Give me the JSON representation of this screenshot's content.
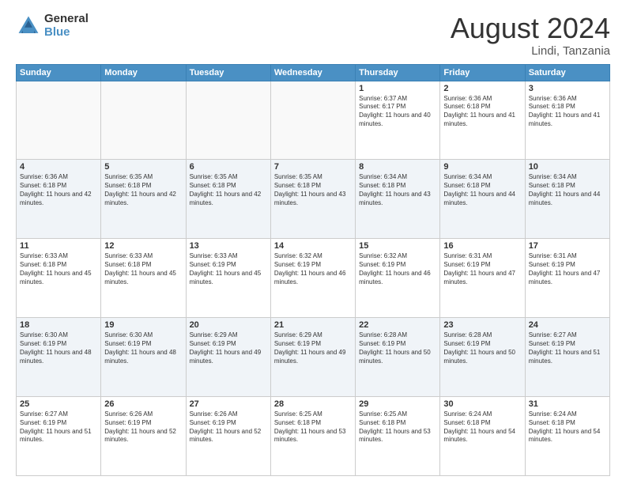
{
  "logo": {
    "general": "General",
    "blue": "Blue"
  },
  "header": {
    "month": "August 2024",
    "location": "Lindi, Tanzania"
  },
  "weekdays": [
    "Sunday",
    "Monday",
    "Tuesday",
    "Wednesday",
    "Thursday",
    "Friday",
    "Saturday"
  ],
  "weeks": [
    [
      {
        "day": "",
        "sunrise": "",
        "sunset": "",
        "daylight": ""
      },
      {
        "day": "",
        "sunrise": "",
        "sunset": "",
        "daylight": ""
      },
      {
        "day": "",
        "sunrise": "",
        "sunset": "",
        "daylight": ""
      },
      {
        "day": "",
        "sunrise": "",
        "sunset": "",
        "daylight": ""
      },
      {
        "day": "1",
        "sunrise": "Sunrise: 6:37 AM",
        "sunset": "Sunset: 6:17 PM",
        "daylight": "Daylight: 11 hours and 40 minutes."
      },
      {
        "day": "2",
        "sunrise": "Sunrise: 6:36 AM",
        "sunset": "Sunset: 6:18 PM",
        "daylight": "Daylight: 11 hours and 41 minutes."
      },
      {
        "day": "3",
        "sunrise": "Sunrise: 6:36 AM",
        "sunset": "Sunset: 6:18 PM",
        "daylight": "Daylight: 11 hours and 41 minutes."
      }
    ],
    [
      {
        "day": "4",
        "sunrise": "Sunrise: 6:36 AM",
        "sunset": "Sunset: 6:18 PM",
        "daylight": "Daylight: 11 hours and 42 minutes."
      },
      {
        "day": "5",
        "sunrise": "Sunrise: 6:35 AM",
        "sunset": "Sunset: 6:18 PM",
        "daylight": "Daylight: 11 hours and 42 minutes."
      },
      {
        "day": "6",
        "sunrise": "Sunrise: 6:35 AM",
        "sunset": "Sunset: 6:18 PM",
        "daylight": "Daylight: 11 hours and 42 minutes."
      },
      {
        "day": "7",
        "sunrise": "Sunrise: 6:35 AM",
        "sunset": "Sunset: 6:18 PM",
        "daylight": "Daylight: 11 hours and 43 minutes."
      },
      {
        "day": "8",
        "sunrise": "Sunrise: 6:34 AM",
        "sunset": "Sunset: 6:18 PM",
        "daylight": "Daylight: 11 hours and 43 minutes."
      },
      {
        "day": "9",
        "sunrise": "Sunrise: 6:34 AM",
        "sunset": "Sunset: 6:18 PM",
        "daylight": "Daylight: 11 hours and 44 minutes."
      },
      {
        "day": "10",
        "sunrise": "Sunrise: 6:34 AM",
        "sunset": "Sunset: 6:18 PM",
        "daylight": "Daylight: 11 hours and 44 minutes."
      }
    ],
    [
      {
        "day": "11",
        "sunrise": "Sunrise: 6:33 AM",
        "sunset": "Sunset: 6:18 PM",
        "daylight": "Daylight: 11 hours and 45 minutes."
      },
      {
        "day": "12",
        "sunrise": "Sunrise: 6:33 AM",
        "sunset": "Sunset: 6:18 PM",
        "daylight": "Daylight: 11 hours and 45 minutes."
      },
      {
        "day": "13",
        "sunrise": "Sunrise: 6:33 AM",
        "sunset": "Sunset: 6:19 PM",
        "daylight": "Daylight: 11 hours and 45 minutes."
      },
      {
        "day": "14",
        "sunrise": "Sunrise: 6:32 AM",
        "sunset": "Sunset: 6:19 PM",
        "daylight": "Daylight: 11 hours and 46 minutes."
      },
      {
        "day": "15",
        "sunrise": "Sunrise: 6:32 AM",
        "sunset": "Sunset: 6:19 PM",
        "daylight": "Daylight: 11 hours and 46 minutes."
      },
      {
        "day": "16",
        "sunrise": "Sunrise: 6:31 AM",
        "sunset": "Sunset: 6:19 PM",
        "daylight": "Daylight: 11 hours and 47 minutes."
      },
      {
        "day": "17",
        "sunrise": "Sunrise: 6:31 AM",
        "sunset": "Sunset: 6:19 PM",
        "daylight": "Daylight: 11 hours and 47 minutes."
      }
    ],
    [
      {
        "day": "18",
        "sunrise": "Sunrise: 6:30 AM",
        "sunset": "Sunset: 6:19 PM",
        "daylight": "Daylight: 11 hours and 48 minutes."
      },
      {
        "day": "19",
        "sunrise": "Sunrise: 6:30 AM",
        "sunset": "Sunset: 6:19 PM",
        "daylight": "Daylight: 11 hours and 48 minutes."
      },
      {
        "day": "20",
        "sunrise": "Sunrise: 6:29 AM",
        "sunset": "Sunset: 6:19 PM",
        "daylight": "Daylight: 11 hours and 49 minutes."
      },
      {
        "day": "21",
        "sunrise": "Sunrise: 6:29 AM",
        "sunset": "Sunset: 6:19 PM",
        "daylight": "Daylight: 11 hours and 49 minutes."
      },
      {
        "day": "22",
        "sunrise": "Sunrise: 6:28 AM",
        "sunset": "Sunset: 6:19 PM",
        "daylight": "Daylight: 11 hours and 50 minutes."
      },
      {
        "day": "23",
        "sunrise": "Sunrise: 6:28 AM",
        "sunset": "Sunset: 6:19 PM",
        "daylight": "Daylight: 11 hours and 50 minutes."
      },
      {
        "day": "24",
        "sunrise": "Sunrise: 6:27 AM",
        "sunset": "Sunset: 6:19 PM",
        "daylight": "Daylight: 11 hours and 51 minutes."
      }
    ],
    [
      {
        "day": "25",
        "sunrise": "Sunrise: 6:27 AM",
        "sunset": "Sunset: 6:19 PM",
        "daylight": "Daylight: 11 hours and 51 minutes."
      },
      {
        "day": "26",
        "sunrise": "Sunrise: 6:26 AM",
        "sunset": "Sunset: 6:19 PM",
        "daylight": "Daylight: 11 hours and 52 minutes."
      },
      {
        "day": "27",
        "sunrise": "Sunrise: 6:26 AM",
        "sunset": "Sunset: 6:19 PM",
        "daylight": "Daylight: 11 hours and 52 minutes."
      },
      {
        "day": "28",
        "sunrise": "Sunrise: 6:25 AM",
        "sunset": "Sunset: 6:18 PM",
        "daylight": "Daylight: 11 hours and 53 minutes."
      },
      {
        "day": "29",
        "sunrise": "Sunrise: 6:25 AM",
        "sunset": "Sunset: 6:18 PM",
        "daylight": "Daylight: 11 hours and 53 minutes."
      },
      {
        "day": "30",
        "sunrise": "Sunrise: 6:24 AM",
        "sunset": "Sunset: 6:18 PM",
        "daylight": "Daylight: 11 hours and 54 minutes."
      },
      {
        "day": "31",
        "sunrise": "Sunrise: 6:24 AM",
        "sunset": "Sunset: 6:18 PM",
        "daylight": "Daylight: 11 hours and 54 minutes."
      }
    ]
  ]
}
